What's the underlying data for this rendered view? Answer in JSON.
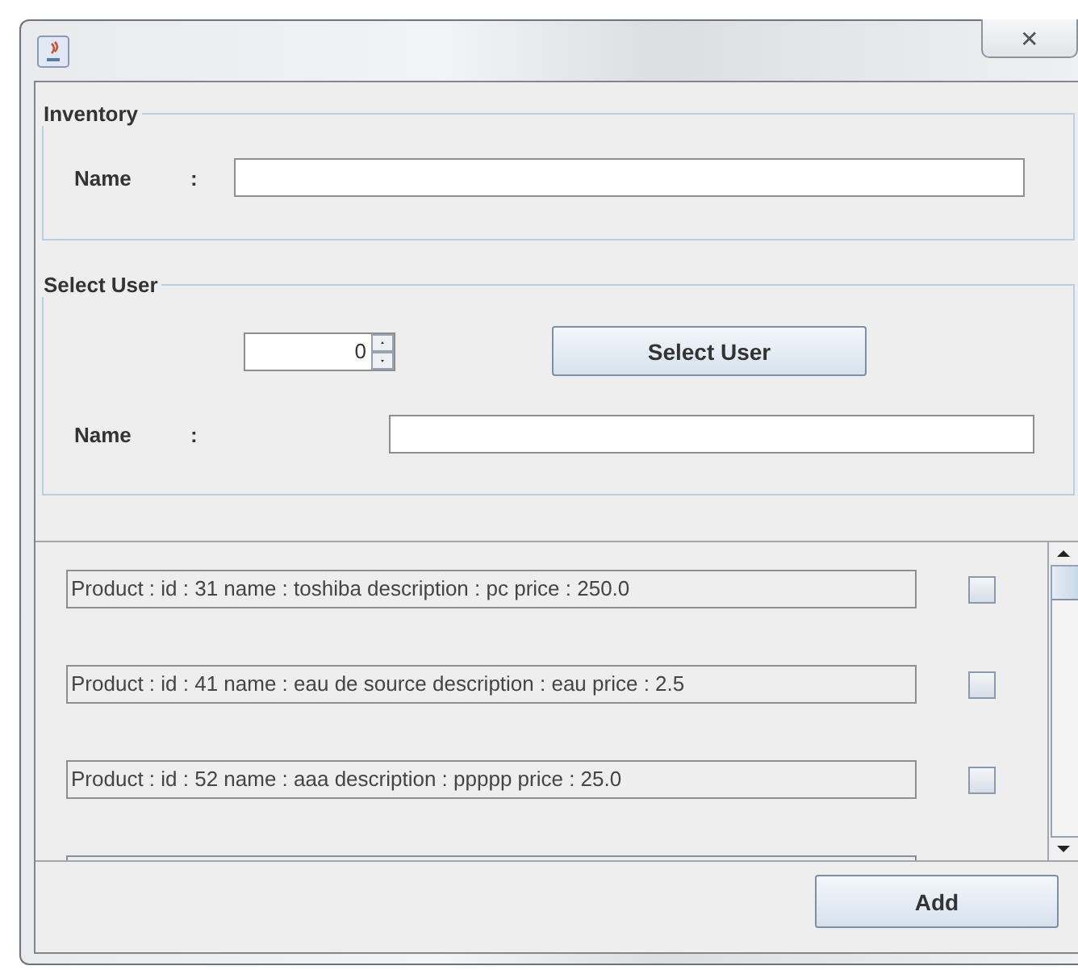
{
  "window": {
    "close_glyph": "✕"
  },
  "inventory": {
    "title": "Inventory",
    "name_label": "Name",
    "separator": ":"
  },
  "select_user": {
    "title": "Select User",
    "spinner_value": "0",
    "button": "Select User",
    "name_label": "Name",
    "separator": ":"
  },
  "products": [
    {
      "text": "Product : id : 31 name : toshiba description : pc price : 250.0",
      "checked": false
    },
    {
      "text": "Product : id : 41 name : eau de source description : eau price : 2.5",
      "checked": false
    },
    {
      "text": "Product : id : 52 name : aaa description : ppppp price : 25.0",
      "checked": false
    }
  ],
  "add_button": "Add"
}
